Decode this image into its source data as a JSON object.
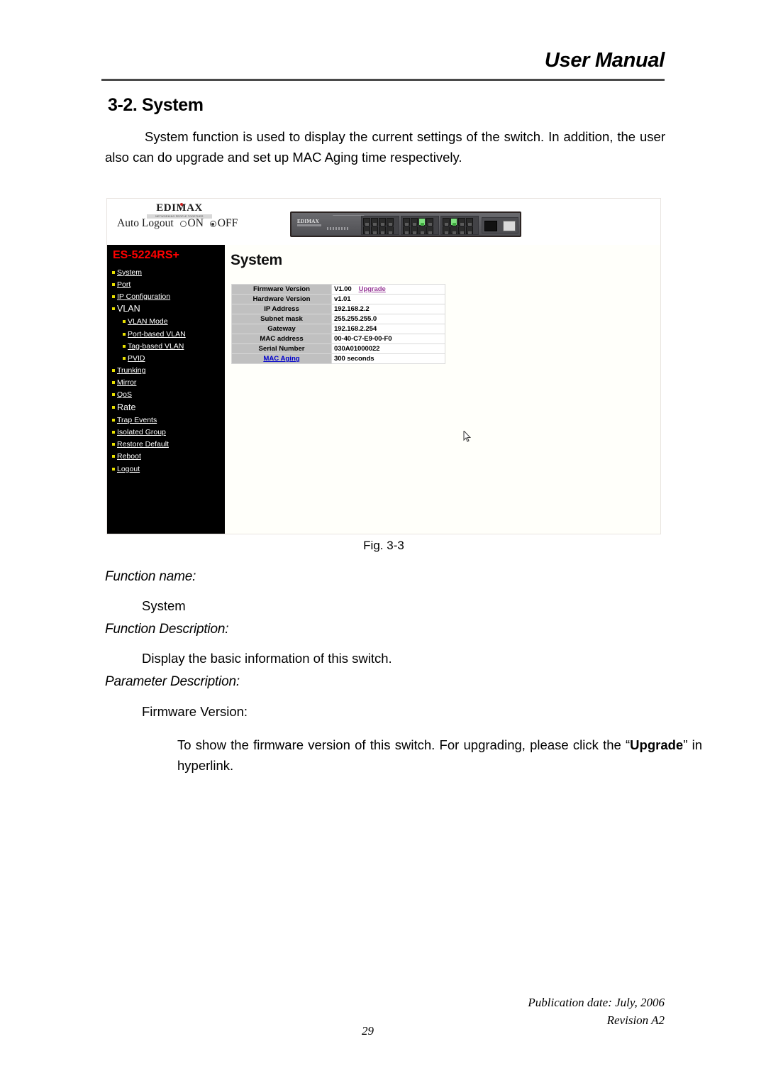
{
  "header": {
    "manual_title": "User Manual"
  },
  "section": {
    "heading": "3-2. System",
    "intro": "System function is used to display the current settings of the switch. In addition, the user also can do upgrade and set up MAC Aging time respectively."
  },
  "figure": {
    "caption": "Fig. 3-3",
    "topbar": {
      "brand": "EDIMAX",
      "brand_tagline": "NETWORKING PEOPLE TOGETHER",
      "auto_logout_label": "Auto Logout",
      "radio_on_label": "ON",
      "radio_off_label": "OFF",
      "selected": "OFF",
      "device_brand": "EDIMAX"
    },
    "nav": {
      "model": "ES-5224RS+",
      "items": [
        {
          "label": "System",
          "sub": false,
          "link": true
        },
        {
          "label": "Port",
          "sub": false,
          "link": true
        },
        {
          "label": "IP Configuration",
          "sub": false,
          "link": true
        },
        {
          "label": "VLAN",
          "sub": false,
          "link": false
        },
        {
          "label": "VLAN Mode",
          "sub": true,
          "link": true
        },
        {
          "label": "Port-based VLAN",
          "sub": true,
          "link": true
        },
        {
          "label": "Tag-based VLAN",
          "sub": true,
          "link": true
        },
        {
          "label": "PVID",
          "sub": true,
          "link": true
        },
        {
          "label": "Trunking",
          "sub": false,
          "link": true
        },
        {
          "label": "Mirror",
          "sub": false,
          "link": true
        },
        {
          "label": "QoS",
          "sub": false,
          "link": true
        },
        {
          "label": "Rate",
          "sub": false,
          "link": false
        },
        {
          "label": "Trap Events",
          "sub": false,
          "link": true
        },
        {
          "label": "Isolated Group",
          "sub": false,
          "link": true
        },
        {
          "label": "Restore Default",
          "sub": false,
          "link": true
        },
        {
          "label": "Reboot",
          "sub": false,
          "link": true
        },
        {
          "label": "Logout",
          "sub": false,
          "link": true
        }
      ]
    },
    "content": {
      "title": "System",
      "table": [
        {
          "label": "Firmware Version",
          "value": "V1.00",
          "link": "Upgrade",
          "link_type": "upgrade"
        },
        {
          "label": "Hardware Version",
          "value": "v1.01"
        },
        {
          "label": "IP Address",
          "value": "192.168.2.2"
        },
        {
          "label": "Subnet mask",
          "value": "255.255.255.0"
        },
        {
          "label": "Gateway",
          "value": "192.168.2.254"
        },
        {
          "label": "MAC address",
          "value": "00-40-C7-E9-00-F0"
        },
        {
          "label": "Serial Number",
          "value": "030A01000022"
        },
        {
          "label": "MAC Aging",
          "value": "300 seconds",
          "label_is_link": true
        }
      ]
    },
    "colors": {
      "model_red": "#ff0000",
      "bullet_yellow": "#e8e000",
      "table_label_gray": "#c0c0c0",
      "upgrade_link": "#9a3f9a",
      "aging_link": "#0000cc"
    }
  },
  "body": {
    "function_name_label": "Function name:",
    "function_name_value": "System",
    "function_description_label": "Function Description:",
    "function_description_value": "Display the basic information of this switch.",
    "parameter_description_label": "Parameter Description:",
    "parameter_name": "Firmware Version:",
    "parameter_text_pre": "To show the firmware version of this switch. For upgrading, please click the “",
    "parameter_text_bold": "Upgrade",
    "parameter_text_post": "” in hyperlink."
  },
  "footer": {
    "publication_date": "Publication date: July, 2006",
    "revision": "Revision A2",
    "page_number": "29"
  }
}
